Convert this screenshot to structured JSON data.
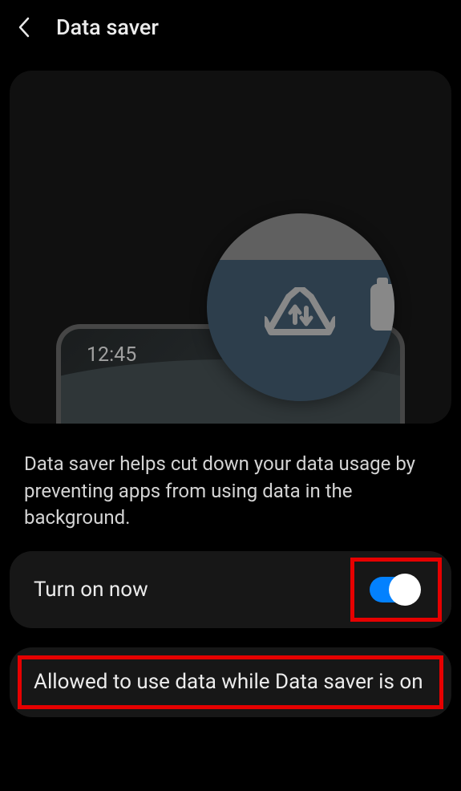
{
  "header": {
    "title": "Data saver"
  },
  "illustration": {
    "phone_time": "12:45"
  },
  "description": "Data saver helps cut down your data usage by preventing apps from using data in the background.",
  "toggle_row": {
    "label": "Turn on now",
    "enabled": true
  },
  "allowed_row": {
    "label": "Allowed to use data while Data saver is on"
  }
}
